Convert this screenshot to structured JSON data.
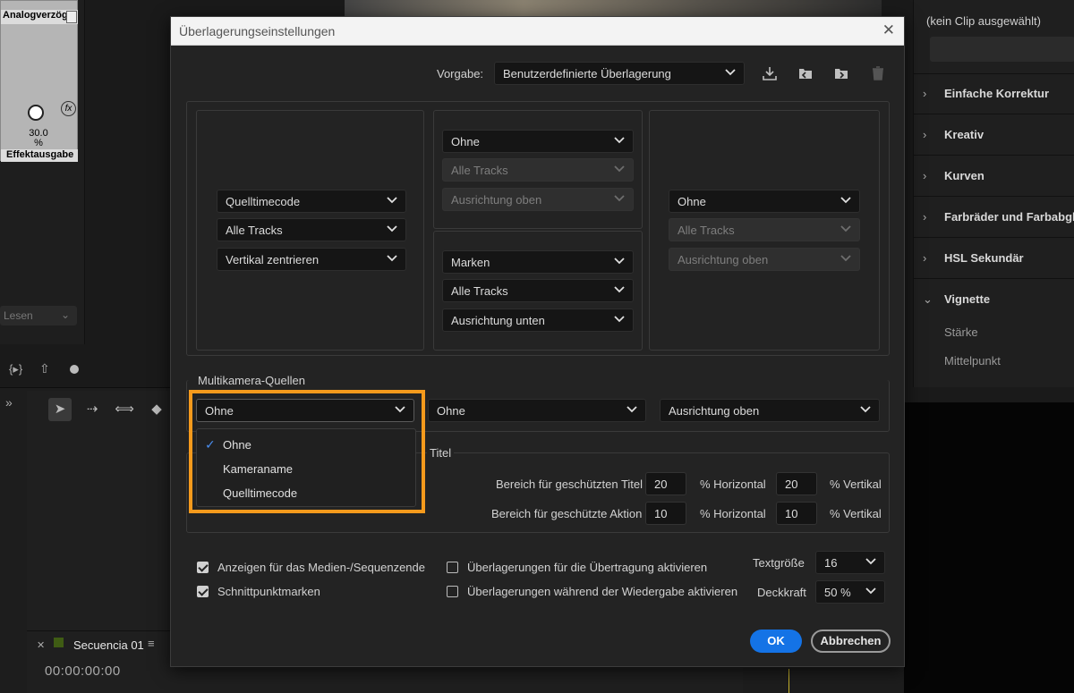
{
  "background": {
    "effect_panel": {
      "title": "Analogverzög",
      "value": "30.0",
      "unit": "%",
      "output_label": "Effektausgabe"
    },
    "lesen_label": "Lesen",
    "right_panel": {
      "no_clip": "(kein Clip ausgewählt)",
      "sections": [
        "Einfache Korrektur",
        "Kreativ",
        "Kurven",
        "Farbräder und Farbabgleich",
        "HSL Sekundär",
        "Vignette"
      ],
      "vignette_items": [
        "Stärke",
        "Mittelpunkt"
      ]
    },
    "sequence": {
      "tab_name": "Secuencia 01",
      "timecode": "00:00:00:00",
      "label_color": "#3f5c14"
    }
  },
  "dialog": {
    "title": "Überlagerungseinstellungen",
    "preset_label": "Vorgabe:",
    "preset_value": "Benutzerdefinierte Überlagerung",
    "left_box": [
      "Quelltimecode",
      "Alle Tracks",
      "Vertikal zentrieren"
    ],
    "center_top_box": [
      "Ohne",
      "Alle Tracks",
      "Ausrichtung oben"
    ],
    "center_bottom_box": [
      "Marken",
      "Alle Tracks",
      "Ausrichtung unten"
    ],
    "right_box": [
      "Ohne",
      "Alle Tracks",
      "Ausrichtung oben"
    ],
    "multicam": {
      "label": "Multikamera-Quellen",
      "dd1": "Ohne",
      "dd2": "Ohne",
      "dd3": "Ausrichtung oben",
      "options": [
        "Ohne",
        "Kameraname",
        "Quelltimecode"
      ],
      "selected_option": "Ohne"
    },
    "safe": {
      "label_fragment": "Titel",
      "title_area_label": "Bereich für geschützten Titel",
      "title_h": "20",
      "title_v": "20",
      "action_area_label": "Bereich für geschützte Aktion",
      "action_h": "10",
      "action_v": "10",
      "horizontal": "% Horizontal",
      "vertical": "% Vertikal"
    },
    "options": {
      "show_end": "Anzeigen für das Medien-/Sequenzende",
      "edit_marks": "Schnittpunktmarken",
      "transmit": "Überlagerungen für die Übertragung aktivieren",
      "playback": "Überlagerungen während der Wiedergabe aktivieren",
      "text_size_label": "Textgröße",
      "text_size": "16",
      "opacity_label": "Deckkraft",
      "opacity": "50 %"
    },
    "ok": "OK",
    "cancel": "Abbrechen",
    "accent_color": "#1473e6",
    "highlight_color": "#f59a1c"
  }
}
